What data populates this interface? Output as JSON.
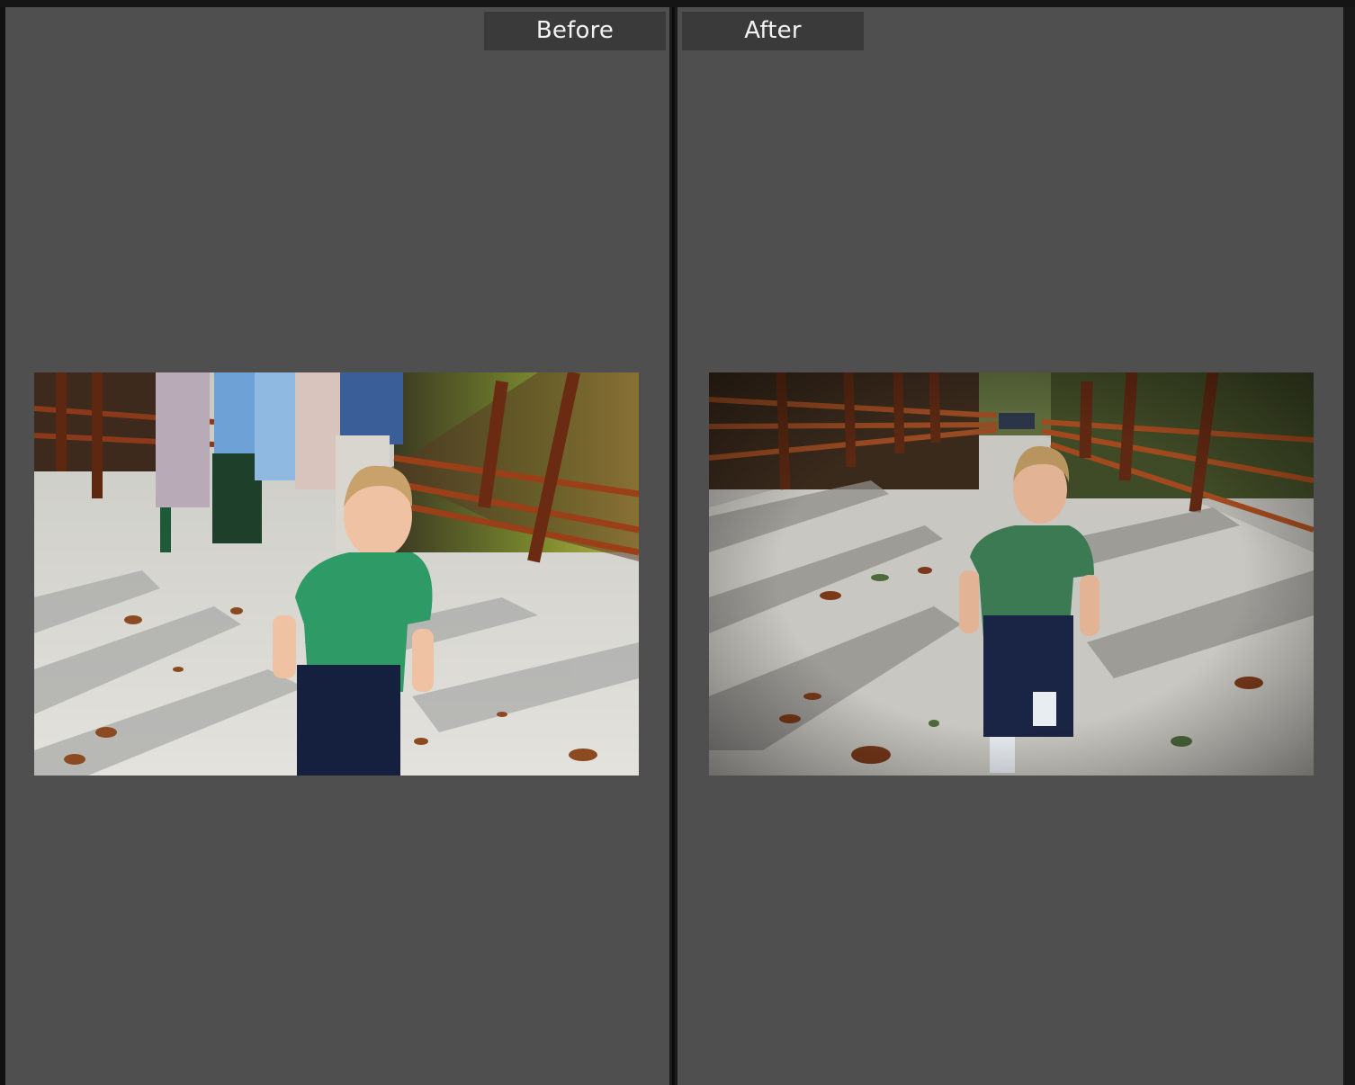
{
  "compare_view": {
    "before": {
      "label": "Before",
      "photo_icon": "photo-icon"
    },
    "after": {
      "label": "After",
      "photo_icon": "photo-icon"
    }
  },
  "colors": {
    "workspace_bg": "#4f4f4f",
    "label_tab_bg": "#3a3a3a",
    "label_text": "#f2f2f2",
    "divider": "#1b1b1b"
  }
}
